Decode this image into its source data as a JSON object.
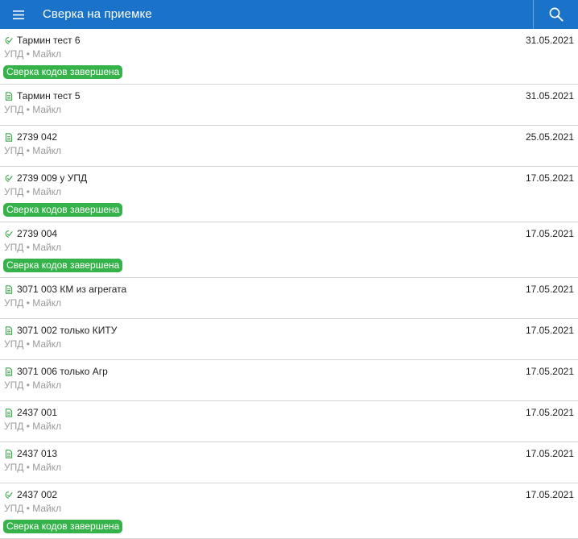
{
  "header": {
    "title": "Сверка на приемке",
    "menu_icon": "menu-icon",
    "search_icon": "search-icon"
  },
  "colors": {
    "appbar": "#1a73c8",
    "badge": "#35b34a",
    "icon_green": "#3aa84a",
    "divider": "#d4d4d4"
  },
  "documents": [
    {
      "name": "Тармин тест 6",
      "meta": "УПД • Майкл",
      "date": "31.05.2021",
      "icon": "doc-check-icon",
      "status": "Сверка кодов завершена"
    },
    {
      "name": "Тармин тест 5",
      "meta": "УПД • Майкл",
      "date": "31.05.2021",
      "icon": "doc-icon",
      "status": ""
    },
    {
      "name": "2739 042",
      "meta": "УПД • Майкл",
      "date": "25.05.2021",
      "icon": "doc-icon",
      "status": ""
    },
    {
      "name": "2739 009 у УПД",
      "meta": "УПД • Майкл",
      "date": "17.05.2021",
      "icon": "doc-check-icon",
      "status": "Сверка кодов завершена"
    },
    {
      "name": "2739 004",
      "meta": "УПД • Майкл",
      "date": "17.05.2021",
      "icon": "doc-check-icon",
      "status": "Сверка кодов завершена"
    },
    {
      "name": "3071 003 КМ из агрегата",
      "meta": "УПД • Майкл",
      "date": "17.05.2021",
      "icon": "doc-icon",
      "status": ""
    },
    {
      "name": "3071 002 только КИТУ",
      "meta": "УПД • Майкл",
      "date": "17.05.2021",
      "icon": "doc-icon",
      "status": ""
    },
    {
      "name": "3071 006 только Агр",
      "meta": "УПД • Майкл",
      "date": "17.05.2021",
      "icon": "doc-icon",
      "status": ""
    },
    {
      "name": "2437 001",
      "meta": "УПД • Майкл",
      "date": "17.05.2021",
      "icon": "doc-icon",
      "status": ""
    },
    {
      "name": "2437 013",
      "meta": "УПД • Майкл",
      "date": "17.05.2021",
      "icon": "doc-icon",
      "status": ""
    },
    {
      "name": "2437 002",
      "meta": "УПД • Майкл",
      "date": "17.05.2021",
      "icon": "doc-check-icon",
      "status": "Сверка кодов завершена"
    }
  ]
}
